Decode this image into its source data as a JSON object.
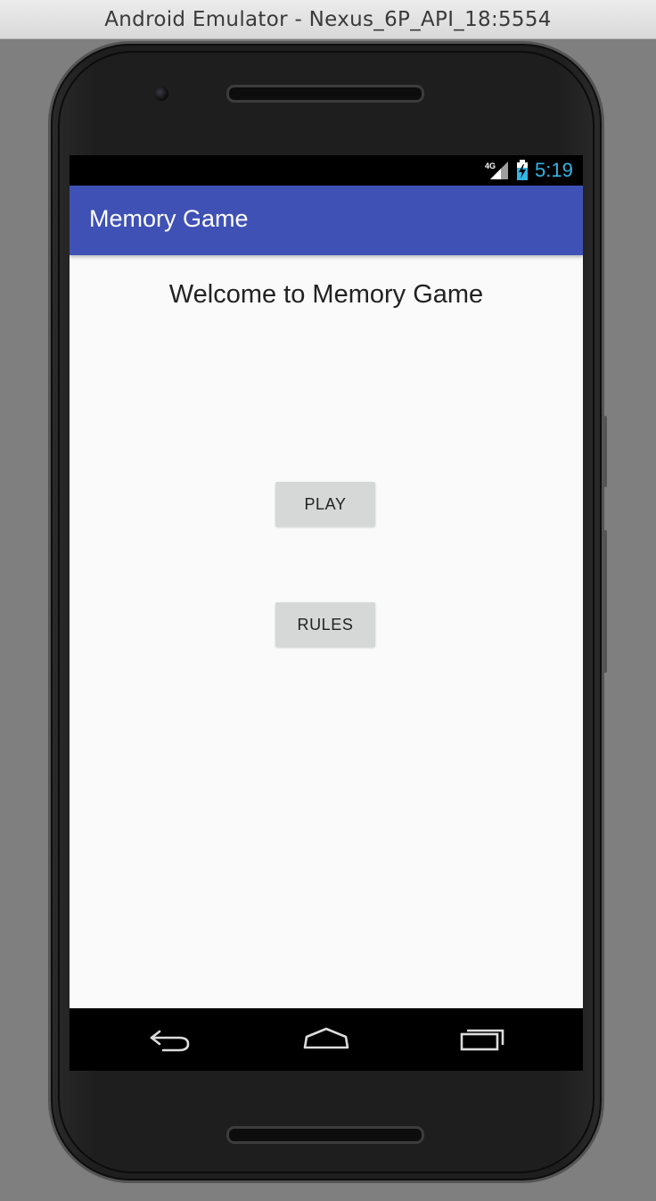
{
  "window": {
    "title": "Android Emulator - Nexus_6P_API_18:5554"
  },
  "status_bar": {
    "time": "5:19",
    "network_label": "4G",
    "network_icon": "cellular-signal-icon",
    "battery_icon": "battery-charging-icon",
    "time_color": "#33b5e5"
  },
  "app_bar": {
    "title": "Memory Game",
    "color": "#3f51b5"
  },
  "main": {
    "welcome": "Welcome to Memory Game",
    "buttons": {
      "play": "PLAY",
      "rules": "RULES"
    }
  },
  "nav_bar": {
    "back_icon": "back-arrow-icon",
    "home_icon": "home-icon",
    "recents_icon": "recent-apps-icon"
  }
}
